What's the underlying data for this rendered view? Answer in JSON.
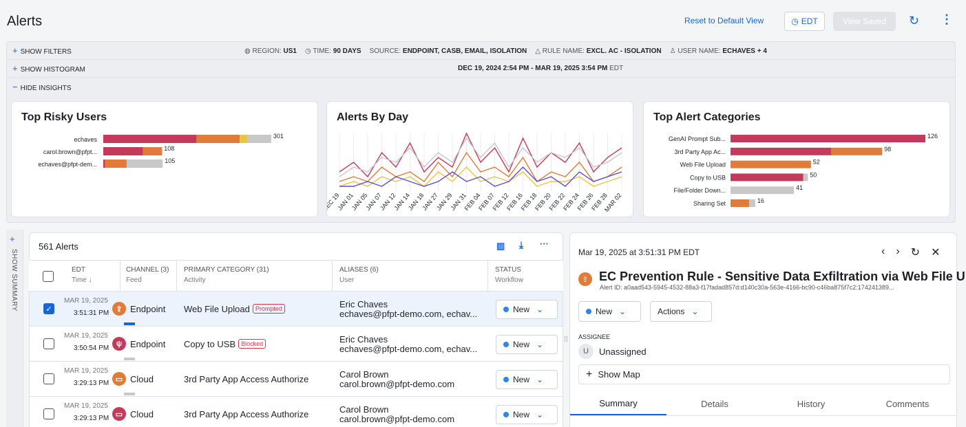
{
  "header": {
    "title": "Alerts",
    "reset_label": "Reset to Default View",
    "tz_label": "EDT",
    "view_saved_label": "View Saved"
  },
  "filters": {
    "show_filters": "SHOW FILTERS",
    "show_histogram": "SHOW HISTOGRAM",
    "hide_insights": "HIDE INSIGHTS",
    "chips": [
      {
        "key": "REGION:",
        "value": "US1"
      },
      {
        "key": "TIME:",
        "value": "90 DAYS"
      },
      {
        "key": "SOURCE:",
        "value": "ENDPOINT, CASB, EMAIL, ISOLATION"
      },
      {
        "key": "RULE NAME:",
        "value": "EXCL. AC - ISOLATION"
      },
      {
        "key": "USER NAME:",
        "value": "ECHAVES + 4"
      }
    ],
    "date_range": "DEC 19, 2024 2:54 PM - MAR 19, 2025 3:54 PM",
    "date_tz": "EDT"
  },
  "insights": {
    "top_users_title": "Top Risky Users",
    "alerts_by_day_title": "Alerts By Day",
    "top_categories_title": "Top Alert Categories"
  },
  "chart_data": [
    {
      "type": "bar",
      "title": "Top Risky Users",
      "categories": [
        "echaves",
        "carol.brown@pfpt...",
        "echaves@pfpt-dem..."
      ],
      "totals": [
        301,
        108,
        105
      ],
      "series": [
        {
          "values": [
            148,
            63,
            3
          ],
          "color": "#c43a5a"
        },
        {
          "values": [
            68,
            30,
            34
          ],
          "color": "#e07b39"
        },
        {
          "values": [
            12,
            0,
            0
          ],
          "color": "#e8c547"
        },
        {
          "values": [
            38,
            0,
            57
          ],
          "color": "#c8c8c8"
        }
      ]
    },
    {
      "type": "line",
      "title": "Alerts By Day",
      "x": [
        "DEC 19",
        "JAN 01",
        "JAN 05",
        "JAN 07",
        "JAN 12",
        "JAN 14",
        "JAN 18",
        "JAN 27",
        "JAN 29",
        "JAN 31",
        "FEB 04",
        "FEB 07",
        "FEB 12",
        "FEB 16",
        "FEB 18",
        "FEB 20",
        "FEB 22",
        "FEB 24",
        "FEB 26",
        "FEB 28",
        "MAR 02"
      ],
      "series": [
        {
          "color": "#c43a5a",
          "values": [
            4,
            6,
            3,
            8,
            5,
            10,
            4,
            7,
            5,
            12,
            6,
            9,
            4,
            11,
            5,
            8,
            6,
            10,
            4,
            7,
            9
          ]
        },
        {
          "color": "#e07b39",
          "values": [
            2,
            3,
            2,
            5,
            3,
            4,
            2,
            6,
            3,
            8,
            4,
            5,
            3,
            7,
            2,
            4,
            3,
            6,
            2,
            3,
            5
          ]
        },
        {
          "color": "#e8c547",
          "values": [
            1,
            2,
            1,
            3,
            2,
            3,
            1,
            4,
            2,
            5,
            2,
            3,
            2,
            4,
            1,
            2,
            2,
            3,
            1,
            2,
            3
          ]
        },
        {
          "color": "#5b4fd6",
          "values": [
            1,
            1,
            2,
            1,
            3,
            2,
            1,
            2,
            4,
            2,
            3,
            1,
            2,
            5,
            2,
            3,
            1,
            4,
            2,
            3,
            4
          ]
        },
        {
          "color": "#c8c8c8",
          "values": [
            3,
            5,
            4,
            7,
            6,
            9,
            5,
            8,
            6,
            11,
            7,
            10,
            5,
            9,
            6,
            8,
            7,
            9,
            5,
            6,
            8
          ]
        }
      ]
    },
    {
      "type": "bar",
      "title": "Top Alert Categories",
      "categories": [
        "GenAI Prompt Sub...",
        "3rd Party App Ac...",
        "Web File Upload",
        "Copy to USB",
        "File/Folder Down...",
        "Sharing Set"
      ],
      "totals": [
        126,
        98,
        52,
        50,
        41,
        16
      ],
      "series": [
        {
          "values": [
            126,
            65,
            0,
            47,
            0,
            0
          ],
          "color": "#c43a5a"
        },
        {
          "values": [
            0,
            33,
            52,
            0,
            0,
            12
          ],
          "color": "#e07b39"
        },
        {
          "values": [
            0,
            0,
            0,
            3,
            41,
            4
          ],
          "color": "#c8c8c8"
        }
      ]
    }
  ],
  "summary_rail": {
    "label": "SHOW SUMMARY"
  },
  "table": {
    "count_label": "561 Alerts",
    "headers": {
      "time": "EDT",
      "time_sub": "Time",
      "channel": "CHANNEL (3)",
      "channel_sub": "Feed",
      "category": "PRIMARY CATEGORY (31)",
      "category_sub": "Activity",
      "aliases": "ALIASES (6)",
      "aliases_sub": "User",
      "status": "STATUS",
      "status_sub": "Workflow"
    },
    "rows": [
      {
        "date": "MAR 19, 2025",
        "time": "3:51:31 PM",
        "channel": "Endpoint",
        "channel_icon": "upload-icon",
        "icon_color": "#e07b39",
        "category": "Web File Upload",
        "tag": "Prompted",
        "name": "Eric Chaves",
        "email": "echaves@pfpt-demo.com, echav...",
        "status": "New",
        "selected": true
      },
      {
        "date": "MAR 19, 2025",
        "time": "3:50:54 PM",
        "channel": "Endpoint",
        "channel_icon": "usb-icon",
        "icon_color": "#c43a5a",
        "category": "Copy to USB",
        "tag": "Blocked",
        "name": "Eric Chaves",
        "email": "echaves@pfpt-demo.com, echav...",
        "status": "New",
        "selected": false
      },
      {
        "date": "MAR 19, 2025",
        "time": "3:29:13 PM",
        "channel": "Cloud",
        "channel_icon": "cloud-app-icon",
        "icon_color": "#e07b39",
        "category": "3rd Party App Access Authorize",
        "tag": "",
        "name": "Carol Brown",
        "email": "carol.brown@pfpt-demo.com",
        "status": "New",
        "selected": false
      },
      {
        "date": "MAR 19, 2025",
        "time": "3:29:13 PM",
        "channel": "Cloud",
        "channel_icon": "cloud-app-icon",
        "icon_color": "#c43a5a",
        "category": "3rd Party App Access Authorize",
        "tag": "",
        "name": "Carol Brown",
        "email": "carol.brown@pfpt-demo.com",
        "status": "New",
        "selected": false
      }
    ]
  },
  "detail": {
    "timestamp": "Mar 19, 2025 at 3:51:31 PM EDT",
    "title": "EC Prevention Rule - Sensitive Data Exfiltration via Web File Uplo...",
    "alert_id": "Alert ID: a0aad543-5945-4532-88a3-f17fadad857d:d140c30a-563e-4166-bc90-c46ba875f7c2:174241389...",
    "status": "New",
    "actions_label": "Actions",
    "assignee_label": "ASSIGNEE",
    "assignee_initial": "U",
    "assignee": "Unassigned",
    "show_map": "Show Map",
    "tabs": [
      "Summary",
      "Details",
      "History",
      "Comments"
    ]
  }
}
